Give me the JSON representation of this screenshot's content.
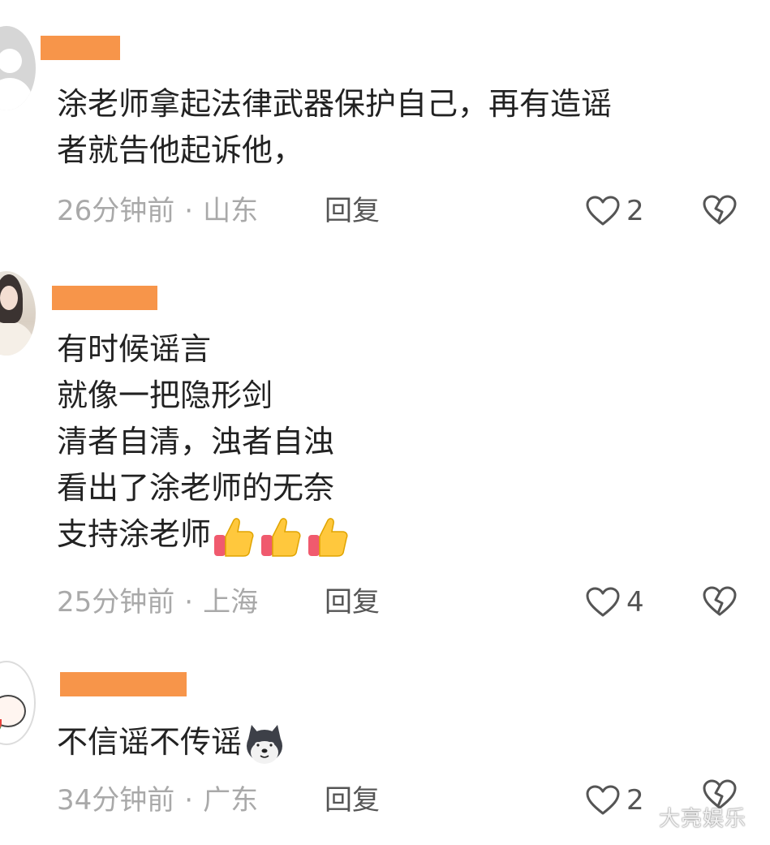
{
  "comments": [
    {
      "lines": [
        "涂老师拿起法律武器保护自己，再有造谣",
        "者就告他起诉他，"
      ],
      "time": "26分钟前",
      "location": "山东",
      "reply_label": "回复",
      "likes": "2"
    },
    {
      "lines": [
        "有时候谣言",
        "就像一把隐形剑",
        "清者自清，浊者自浊",
        "看出了涂老师的无奈",
        "支持涂老师"
      ],
      "time": "25分钟前",
      "location": "上海",
      "reply_label": "回复",
      "likes": "4"
    },
    {
      "lines": [
        "不信谣不传谣"
      ],
      "time": "34分钟前",
      "location": "广东",
      "reply_label": "回复",
      "likes": "2"
    }
  ],
  "separator": "·",
  "icons": {
    "like": "heart-outline-icon",
    "dislike": "broken-heart-icon",
    "thumbs_up": "thumbs-up-emoji",
    "husky": "husky-dog-emoji"
  },
  "colors": {
    "redaction": "#f7954a",
    "text": "#222222",
    "meta": "#a9a9a9"
  },
  "watermark": "大亮娱乐"
}
